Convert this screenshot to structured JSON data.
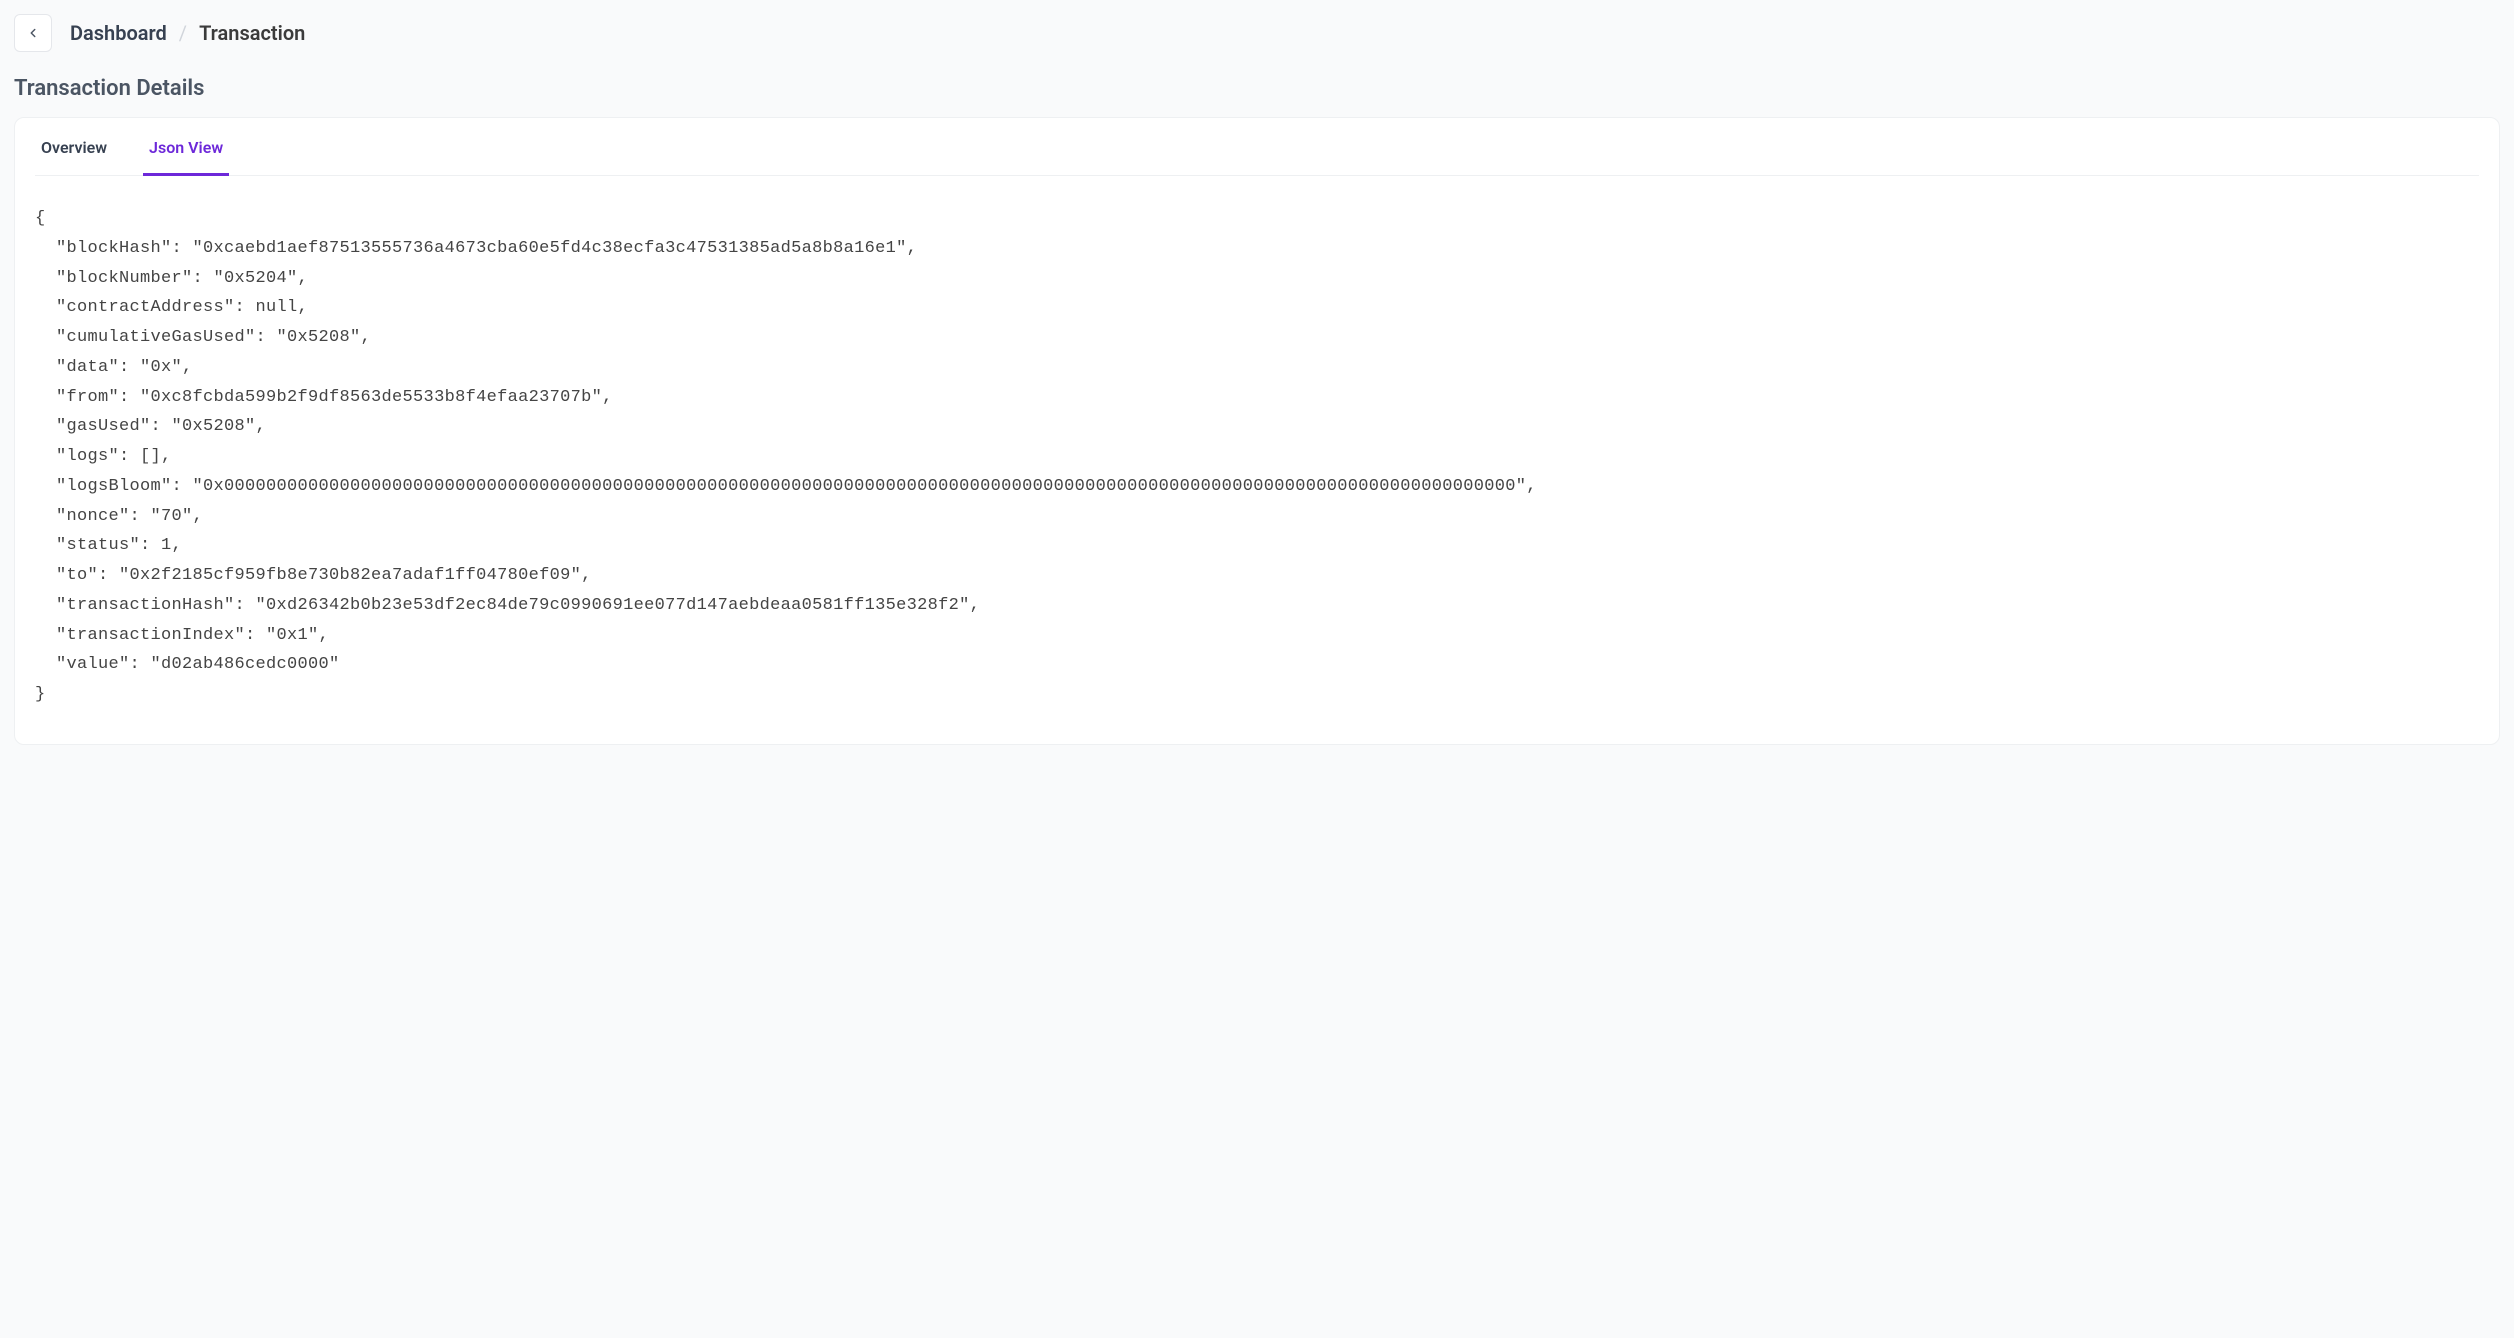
{
  "breadcrumb": {
    "home": "Dashboard",
    "current": "Transaction"
  },
  "page_title": "Transaction Details",
  "tabs": {
    "overview": "Overview",
    "json_view": "Json View"
  },
  "transaction": {
    "blockHash": "0xcaebd1aef87513555736a4673cba60e5fd4c38ecfa3c47531385ad5a8b8a16e1",
    "blockNumber": "0x5204",
    "contractAddress": null,
    "cumulativeGasUsed": "0x5208",
    "data": "0x",
    "from": "0xc8fcbda599b2f9df8563de5533b8f4efaa23707b",
    "gasUsed": "0x5208",
    "logs": [],
    "logsBloom": "0x000000000000000000000000000000000000000000000000000000000000000000000000000000000000000000000000000000000000000000000000000",
    "nonce": "70",
    "status": 1,
    "to": "0x2f2185cf959fb8e730b82ea7adaf1ff04780ef09",
    "transactionHash": "0xd26342b0b23e53df2ec84de79c0990691ee077d147aebdeaa0581ff135e328f2",
    "transactionIndex": "0x1",
    "value": "d02ab486cedc0000"
  }
}
